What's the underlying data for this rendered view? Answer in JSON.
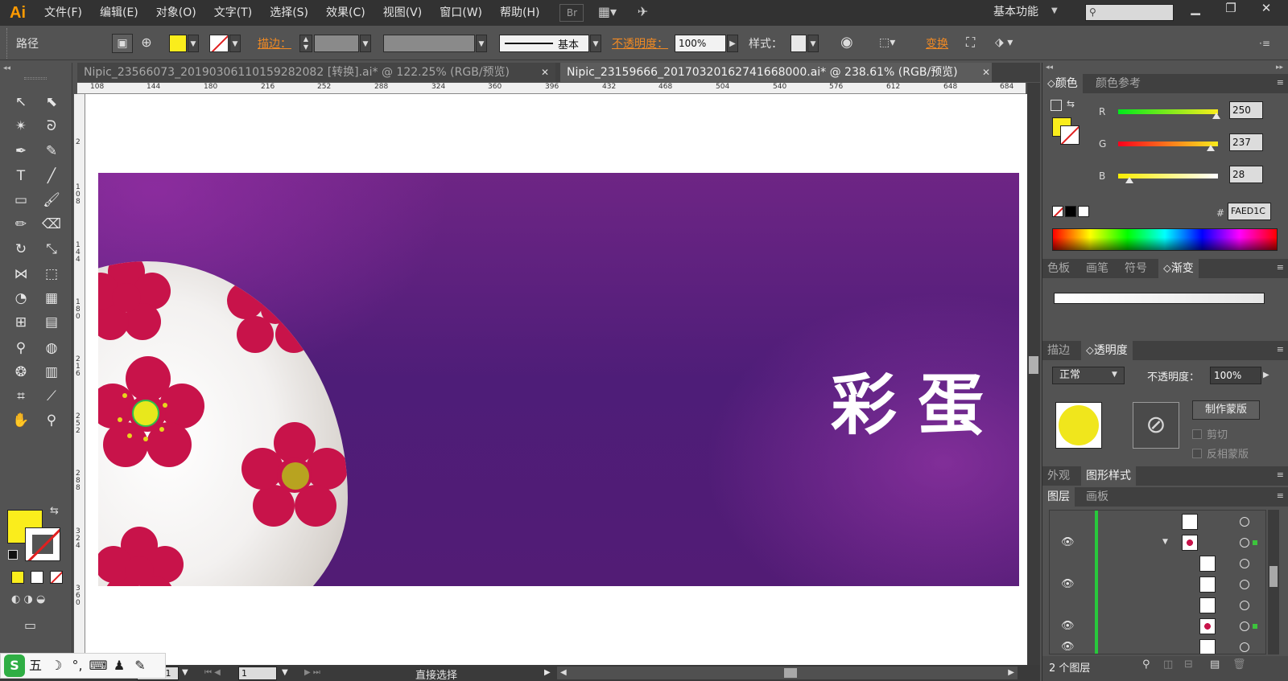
{
  "app": {
    "logo": "Ai"
  },
  "menu": [
    "文件(F)",
    "编辑(E)",
    "对象(O)",
    "文字(T)",
    "选择(S)",
    "效果(C)",
    "视图(V)",
    "窗口(W)",
    "帮助(H)"
  ],
  "menubar_icons": {
    "bridge": "Br"
  },
  "workspace": {
    "label": "基本功能"
  },
  "window_controls": {
    "minimize": "▁",
    "restore": "❐",
    "close": "✕"
  },
  "control_bar": {
    "selection": "路径",
    "stroke_label": "描边：",
    "stroke_style": "基本",
    "opacity_label": "不透明度：",
    "opacity_value": "100%",
    "style_label": "样式：",
    "transform_label": "变换"
  },
  "tabs": [
    {
      "title": "Nipic_23566073_20190306110159282082 [转换].ai* @ 122.25% (RGB/预览)",
      "active": false
    },
    {
      "title": "Nipic_23159666_20170320162741668000.ai* @ 238.61% (RGB/预览)",
      "active": true
    }
  ],
  "ruler_top": [
    "108",
    "144",
    "180",
    "216",
    "252",
    "288",
    "324",
    "360",
    "396",
    "432",
    "468",
    "504",
    "540",
    "576",
    "612",
    "648",
    "684"
  ],
  "ruler_left": [
    "2",
    "1 0 8",
    "1 4 4",
    "1 8 0",
    "2 1 6",
    "2 5 2",
    "2 8 8",
    "3 2 4",
    "3 6 0"
  ],
  "artwork": {
    "title": "彩蛋",
    "colors": {
      "bg_purple": "#5a1e7c",
      "petal": "#c8134a",
      "center": "#e8d51c",
      "center_dark": "#b8a320"
    }
  },
  "status_bar": {
    "zoom": "238.61",
    "page": "1",
    "tool": "直接选择"
  },
  "ime_items": [
    "S",
    "五",
    "☽",
    "°,",
    "⌨",
    "♟",
    "✎"
  ],
  "color_panel": {
    "tabs": [
      "颜色",
      "颜色参考"
    ],
    "r_label": "R",
    "g_label": "G",
    "b_label": "B",
    "r": "250",
    "g": "237",
    "b": "28",
    "r_fraction": 0.98,
    "g_fraction": 0.93,
    "b_fraction": 0.11,
    "hex_label": "#",
    "hex": "FAED1C",
    "fill_color": "#faed1c"
  },
  "swatch_panel": {
    "tabs": [
      "色板",
      "画笔",
      "符号",
      "渐变"
    ]
  },
  "transparency_panel": {
    "tabs": [
      "描边",
      "透明度"
    ],
    "blend_mode": "正常",
    "opacity_label": "不透明度：",
    "opacity": "100%",
    "make_mask": "制作蒙版",
    "clip": "剪切",
    "invert_mask": "反相蒙版"
  },
  "appearance_panel": {
    "tabs": [
      "外观",
      "图形样式"
    ]
  },
  "layers_panel": {
    "tabs": [
      "图层",
      "画板"
    ],
    "footer": "2 个图层"
  }
}
